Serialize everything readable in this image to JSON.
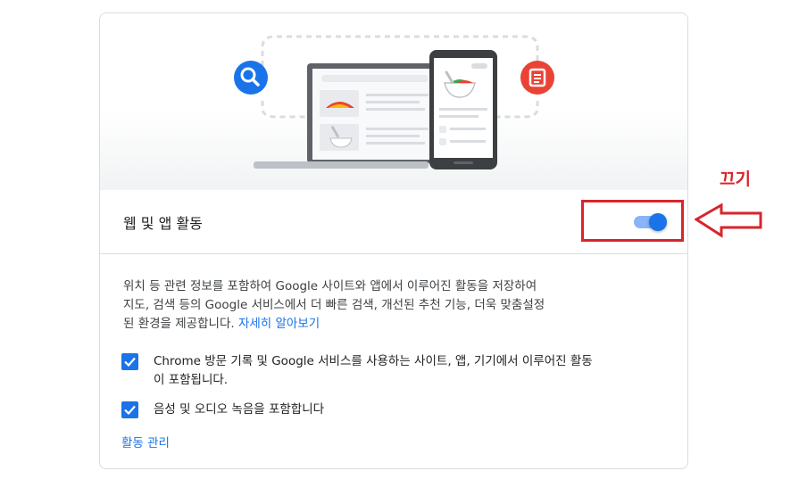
{
  "colors": {
    "accent": "#1a73e8",
    "annotation": "#d6262b",
    "search_circle": "#1a73e8",
    "doc_circle": "#ea4335"
  },
  "hero": {
    "icons": [
      "search-icon",
      "document-icon",
      "laptop",
      "phone"
    ]
  },
  "activity": {
    "title": "웹 및 앱 활동",
    "toggle_on": true
  },
  "description": {
    "line1": "위치 등 관련 정보를 포함하여 Google 사이트와 앱에서 이루어진 활동을 저장하여",
    "line2": "지도, 검색 등의 Google 서비스에서 더 빠른 검색, 개선된 추천 기능, 더욱 맞춤설정",
    "line3": "된 환경을 제공합니다. ",
    "learn_more": "자세히 알아보기"
  },
  "options": {
    "chrome_line1": "Chrome 방문 기록 및 Google 서비스를 사용하는 사이트, 앱, 기기에서 이루어진 활동",
    "chrome_line2": "이 포함됩니다.",
    "chrome_checked": true,
    "audio": "음성 및 오디오 녹음을 포함합니다",
    "audio_checked": true
  },
  "manage_link": "활동 관리",
  "annotation": {
    "label": "끄기"
  }
}
